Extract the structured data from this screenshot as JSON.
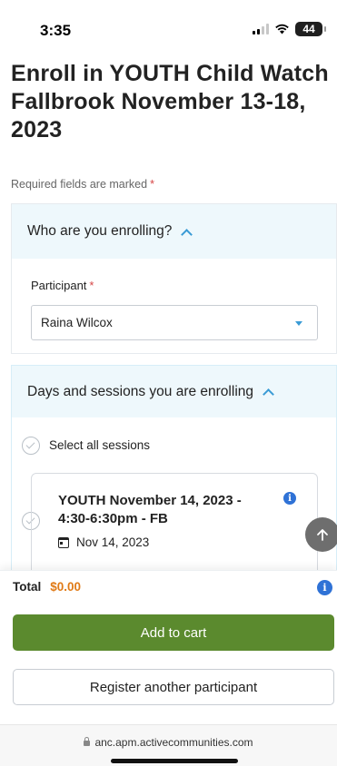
{
  "status_bar": {
    "time": "3:35",
    "battery": "44"
  },
  "page": {
    "title": "Enroll in YOUTH Child Watch Fallbrook November 13-18, 2023",
    "required_note": "Required fields are marked",
    "required_marker": "*"
  },
  "who_section": {
    "header": "Who are you enrolling?",
    "participant_label": "Participant",
    "participant_value": "Raina Wilcox"
  },
  "days_section": {
    "header": "Days and sessions you are enrolling",
    "select_all_label": "Select all sessions",
    "sessions": [
      {
        "title": "YOUTH November 14, 2023 - 4:30-6:30pm - FB",
        "date": "Nov 14, 2023"
      }
    ]
  },
  "footer": {
    "total_label": "Total",
    "total_value": "$0.00",
    "add_to_cart": "Add to cart",
    "register_another": "Register another participant"
  },
  "browser": {
    "url": "anc.apm.activecommunities.com"
  },
  "colors": {
    "accent": "#3a9bd5",
    "primary_button": "#5b8a2e",
    "total": "#e07a16",
    "info": "#2f72d6",
    "required": "#d64545"
  }
}
